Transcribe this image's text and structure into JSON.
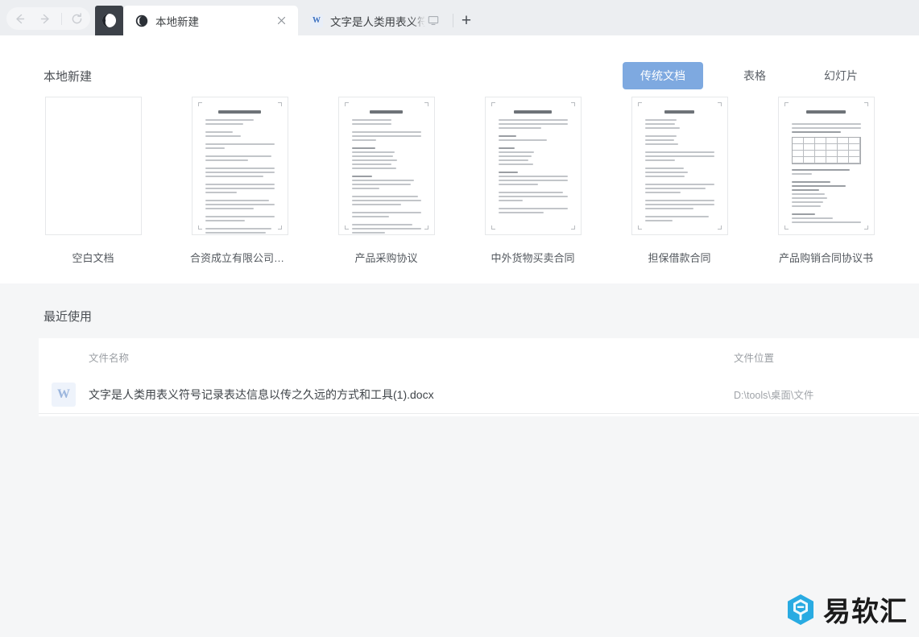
{
  "window": {
    "nav": {
      "back_icon": "arrow-left-icon",
      "forward_icon": "arrow-right-icon",
      "refresh_icon": "refresh-icon"
    },
    "app_logo_icon": "wps-logo-icon",
    "tabs": [
      {
        "title": "本地新建",
        "icon": "wps-logo-icon",
        "active": true,
        "close_label": "×"
      },
      {
        "title": "文字是人类用表义符号记",
        "icon": "word-document-icon",
        "active": false,
        "cast_icon": "cast-screen-icon"
      }
    ],
    "new_tab_label": "+"
  },
  "templates": {
    "section_title": "本地新建",
    "categories": [
      {
        "label": "传统文档",
        "active": true
      },
      {
        "label": "表格",
        "active": false
      },
      {
        "label": "幻灯片",
        "active": false
      }
    ],
    "items": [
      {
        "label": "空白文档",
        "kind": "blank"
      },
      {
        "label": "合资成立有限公司协...",
        "kind": "text"
      },
      {
        "label": "产品采购协议",
        "kind": "text"
      },
      {
        "label": "中外货物买卖合同",
        "kind": "text"
      },
      {
        "label": "担保借款合同",
        "kind": "text"
      },
      {
        "label": "产品购销合同协议书",
        "kind": "table"
      }
    ]
  },
  "recent": {
    "section_title": "最近使用",
    "columns": {
      "name": "文件名称",
      "location": "文件位置"
    },
    "rows": [
      {
        "icon": "word-document-icon",
        "icon_letter": "W",
        "name": "文字是人类用表义符号记录表达信息以传之久远的方式和工具(1).docx",
        "location": "D:\\tools\\桌面\\文件"
      }
    ]
  },
  "watermark": {
    "text": "易软汇",
    "logo_icon": "yiruanhui-hex-logo-icon",
    "color": "#29abe2"
  },
  "theme": {
    "accent": "#7ea9e0",
    "titlebar_bg": "#eceef1",
    "panel_bg": "#f5f6f7",
    "page_bg": "#ffffff"
  }
}
